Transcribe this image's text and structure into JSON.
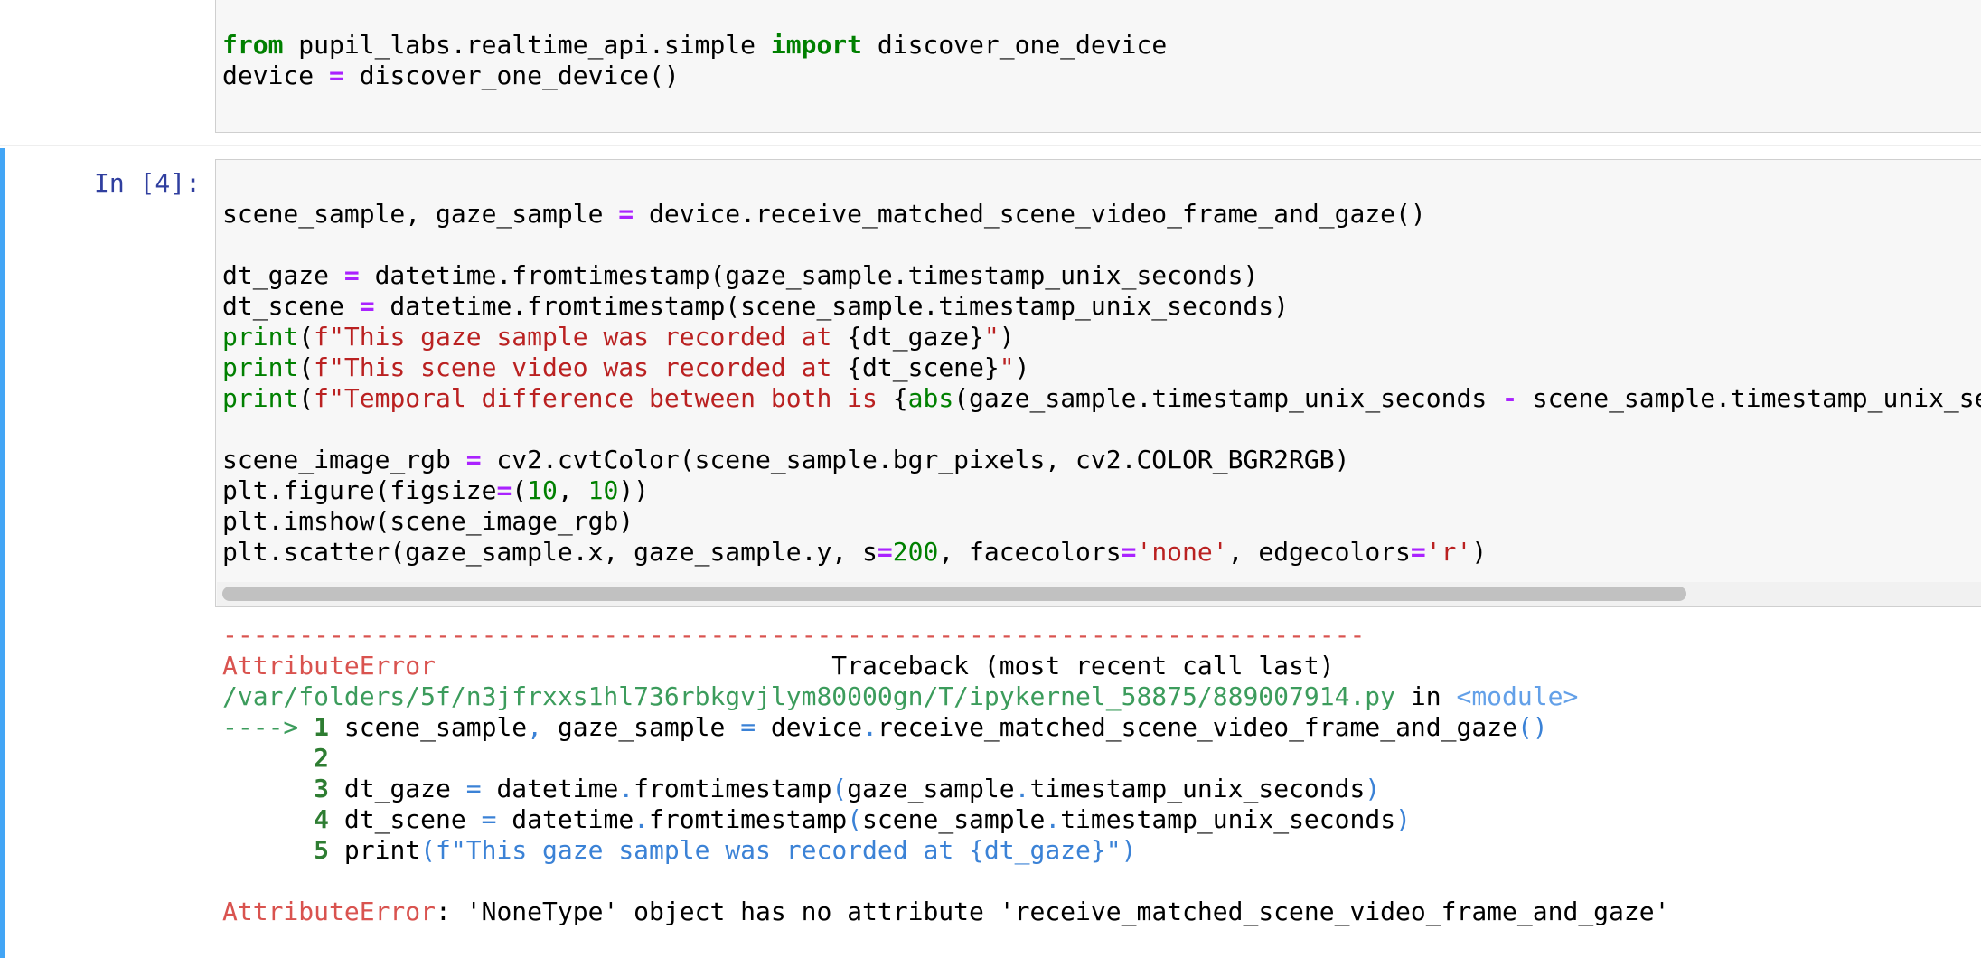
{
  "prev_cell": {
    "lines": [
      [
        "from",
        " pupil_labs.realtime_api.simple ",
        "import",
        " discover_one_device"
      ],
      [
        "device ",
        "=",
        " discover_one_device()"
      ]
    ]
  },
  "cell": {
    "prompt": "In [4]:",
    "code": {
      "l1": [
        "scene_sample, gaze_sample ",
        "=",
        " device.receive_matched_scene_video_frame_and_gaze()"
      ],
      "l3": [
        "dt_gaze ",
        "=",
        " datetime.fromtimestamp(gaze_sample.timestamp_unix_seconds)"
      ],
      "l4": [
        "dt_scene ",
        "=",
        " datetime.fromtimestamp(scene_sample.timestamp_unix_seconds)"
      ],
      "l5": [
        "print",
        "(",
        "f\"This gaze sample was recorded at ",
        "{dt_gaze}",
        "\"",
        ")"
      ],
      "l6": [
        "print",
        "(",
        "f\"This scene video was recorded at ",
        "{dt_scene}",
        "\"",
        ")"
      ],
      "l7": [
        "print",
        "(",
        "f\"Temporal difference between both is ",
        "{",
        "abs",
        "(gaze_sample.timestamp_unix_seconds ",
        "-",
        " scene_sample.timestamp_unix_se"
      ],
      "l9": [
        "scene_image_rgb ",
        "=",
        " cv2.cvtColor(scene_sample.bgr_pixels, cv2.COLOR_BGR2RGB)"
      ],
      "l10": [
        "plt.figure(figsize",
        "=",
        "(",
        "10",
        ", ",
        "10",
        "))"
      ],
      "l11": [
        "plt.imshow(scene_image_rgb)"
      ],
      "l12": [
        "plt.scatter(gaze_sample.x, gaze_sample.y, s",
        "=",
        "200",
        ", facecolors",
        "=",
        "'none'",
        ", edgecolors",
        "=",
        "'r'",
        ")"
      ]
    }
  },
  "output": {
    "dashes": "---------------------------------------------------------------------------",
    "error_name": "AttributeError",
    "traceback_header": "                          Traceback (most recent call last)",
    "file_path": "/var/folders/5f/n3jfrxxs1hl736rbkgvjlym80000gn/T/ipykernel_58875/889007914.py",
    "in_text": " in ",
    "module": "<module>",
    "arrow": "---->",
    "tb_lines": [
      {
        "num": "1",
        "parts": [
          "scene_sample",
          ",",
          " gaze_sample ",
          "=",
          " device",
          ".",
          "receive_matched_scene_video_frame_and_gaze",
          "()"
        ]
      },
      {
        "num": "2",
        "parts": []
      },
      {
        "num": "3",
        "parts": [
          "dt_gaze ",
          "=",
          " datetime",
          ".",
          "fromtimestamp",
          "(",
          "gaze_sample",
          ".",
          "timestamp_unix_seconds",
          ")"
        ]
      },
      {
        "num": "4",
        "parts": [
          "dt_scene ",
          "=",
          " datetime",
          ".",
          "fromtimestamp",
          "(",
          "scene_sample",
          ".",
          "timestamp_unix_seconds",
          ")"
        ]
      },
      {
        "num": "5",
        "parts": [
          "print",
          "(f\"This gaze sample was recorded at {dt_gaze}\")"
        ]
      }
    ],
    "final_error_msg": ": 'NoneType' object has no attribute 'receive_matched_scene_video_frame_and_gaze'"
  }
}
